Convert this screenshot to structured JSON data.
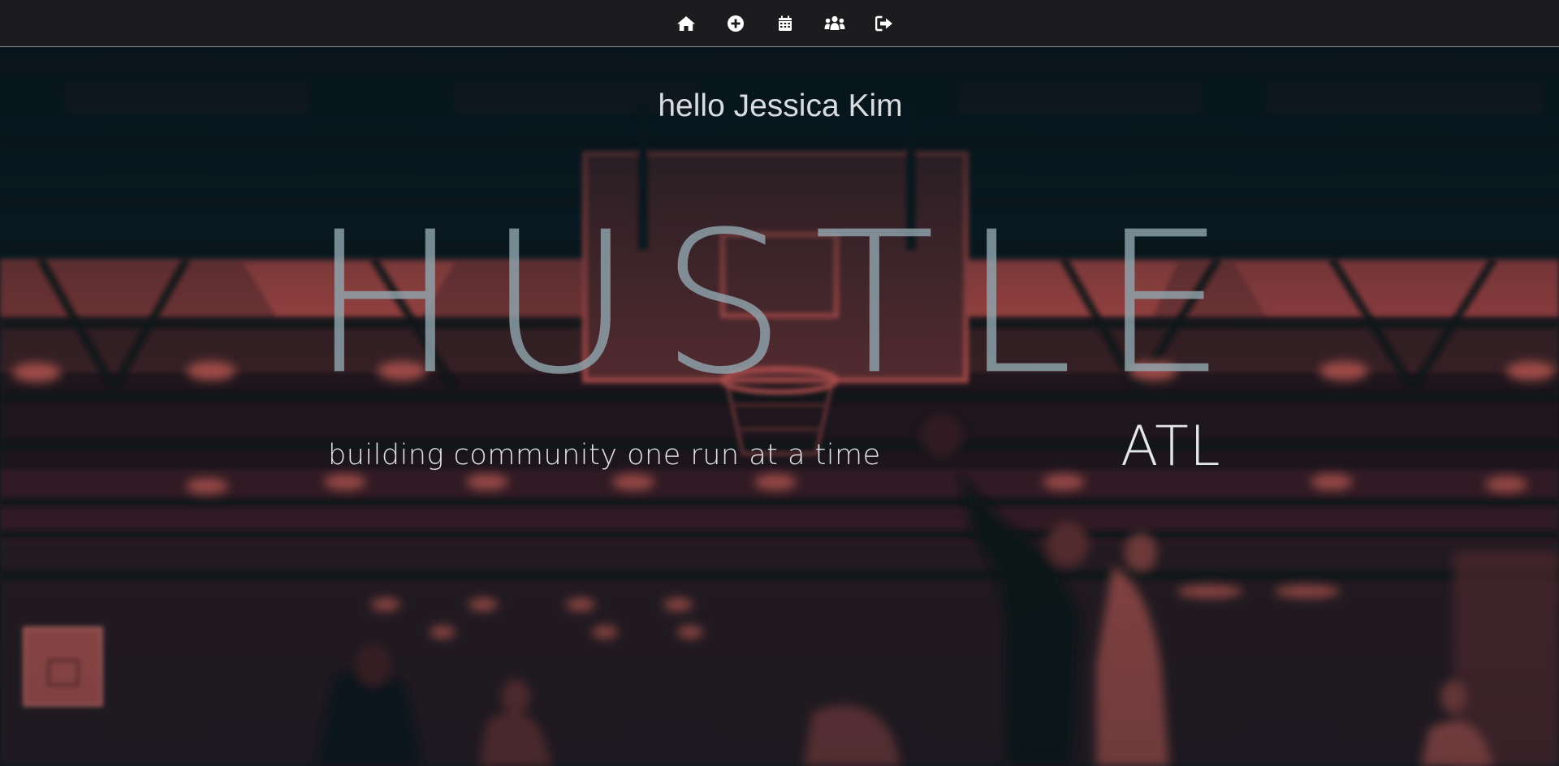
{
  "nav": {
    "items": [
      {
        "icon": "home-icon",
        "label": "Home"
      },
      {
        "icon": "plus-circle-icon",
        "label": "Add run"
      },
      {
        "icon": "calendar-icon",
        "label": "Calendar"
      },
      {
        "icon": "users-icon",
        "label": "Community"
      },
      {
        "icon": "sign-out-icon",
        "label": "Sign out"
      }
    ]
  },
  "hero": {
    "greeting": "hello Jessica Kim",
    "title": "HUSTLE",
    "city": "ATL",
    "tagline": "building community one run at a time",
    "background_description_icon": "basketball-gym-photo",
    "overlay_color": "#b84a48",
    "shadow_color": "#08161d"
  }
}
